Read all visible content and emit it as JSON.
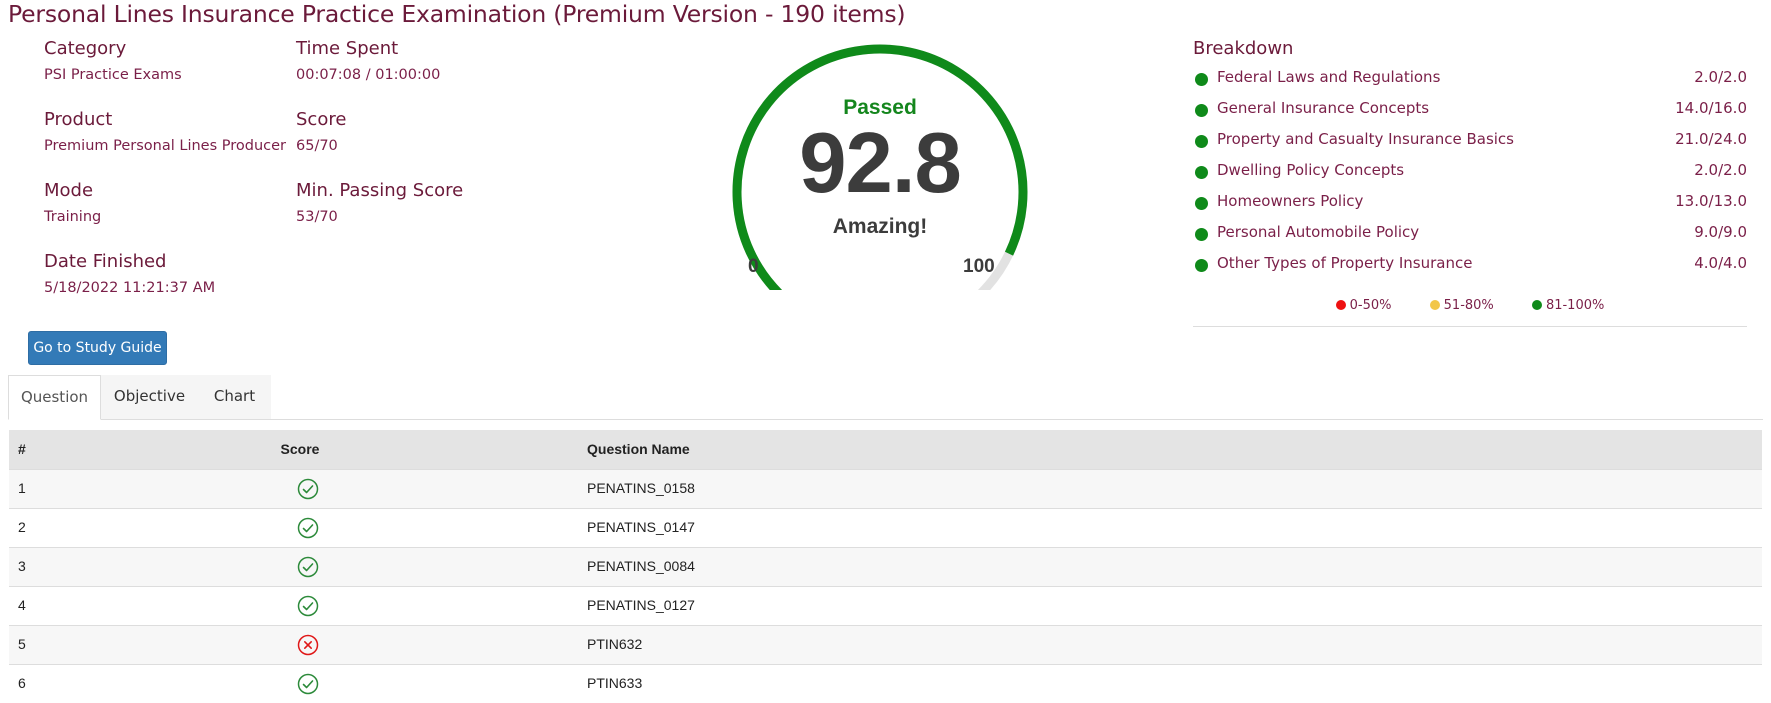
{
  "header": {
    "title": "Personal Lines Insurance Practice Examination (Premium Version - 190 items)"
  },
  "info": {
    "category": {
      "label": "Category",
      "value": "PSI Practice Exams"
    },
    "product": {
      "label": "Product",
      "value": "Premium Personal Lines Producer"
    },
    "mode": {
      "label": "Mode",
      "value": "Training"
    },
    "date_finished": {
      "label": "Date Finished",
      "value": "5/18/2022 11:21:37 AM"
    },
    "time_spent": {
      "label": "Time Spent",
      "value": "00:07:08 / 01:00:00"
    },
    "score": {
      "label": "Score",
      "value": "65/70"
    },
    "min_passing": {
      "label": "Min. Passing Score",
      "value": "53/70"
    }
  },
  "study_button": {
    "label": "Go to Study Guide"
  },
  "gauge": {
    "status": "Passed",
    "score": "92.8",
    "value": 92.8,
    "min_label": "0",
    "max_label": "100",
    "message": "Amazing!",
    "fill_color": "#0f8a1a",
    "track_color": "#e2e2e2"
  },
  "breakdown": {
    "title": "Breakdown",
    "items": [
      {
        "name": "Federal Laws and Regulations",
        "value": "2.0/2.0",
        "color": "#0f8a1a"
      },
      {
        "name": "General Insurance Concepts",
        "value": "14.0/16.0",
        "color": "#0f8a1a"
      },
      {
        "name": "Property and Casualty Insurance Basics",
        "value": "21.0/24.0",
        "color": "#0f8a1a"
      },
      {
        "name": "Dwelling Policy Concepts",
        "value": "2.0/2.0",
        "color": "#0f8a1a"
      },
      {
        "name": "Homeowners Policy",
        "value": "13.0/13.0",
        "color": "#0f8a1a"
      },
      {
        "name": "Personal Automobile Policy",
        "value": "9.0/9.0",
        "color": "#0f8a1a"
      },
      {
        "name": "Other Types of Property Insurance",
        "value": "4.0/4.0",
        "color": "#0f8a1a"
      }
    ],
    "legend": [
      {
        "label": "0-50%",
        "color": "#ee1111"
      },
      {
        "label": "51-80%",
        "color": "#f2c649"
      },
      {
        "label": "81-100%",
        "color": "#0f8a1a"
      }
    ]
  },
  "tabs": [
    {
      "label": "Question",
      "active": true
    },
    {
      "label": "Objective",
      "active": false
    },
    {
      "label": "Chart",
      "active": false
    }
  ],
  "table": {
    "columns": [
      "#",
      "Score",
      "Question Name"
    ],
    "rows": [
      {
        "num": "1",
        "correct": true,
        "name": "PENATINS_0158"
      },
      {
        "num": "2",
        "correct": true,
        "name": "PENATINS_0147"
      },
      {
        "num": "3",
        "correct": true,
        "name": "PENATINS_0084"
      },
      {
        "num": "4",
        "correct": true,
        "name": "PENATINS_0127"
      },
      {
        "num": "5",
        "correct": false,
        "name": "PTIN632"
      },
      {
        "num": "6",
        "correct": true,
        "name": "PTIN633"
      }
    ]
  }
}
